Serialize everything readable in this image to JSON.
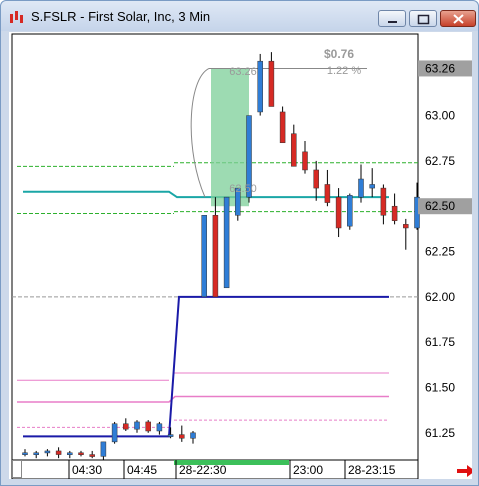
{
  "window": {
    "title": "S.FSLR - First Solar, Inc, 3 Min"
  },
  "chart_data": {
    "type": "candlestick",
    "ylim": [
      61.1,
      63.45
    ],
    "y_ticks": [
      "61.25",
      "61.50",
      "61.75",
      "62.00",
      "62.25",
      "62.50",
      "62.75",
      "63.00",
      "63.26"
    ],
    "x_tick_labels": [
      "04:30",
      "04:45",
      "28-22:30",
      "23:00",
      "28-23:15"
    ],
    "price_boxes": [
      {
        "value": 63.26,
        "label": "63.26"
      },
      {
        "value": 62.5,
        "label": "62.50"
      }
    ],
    "annotation": {
      "change": "$0.76",
      "percent": "1.22 %",
      "high_label": "63.26",
      "low_label": "62.50"
    },
    "candles": [
      {
        "o": 61.14,
        "h": 61.16,
        "l": 61.12,
        "c": 61.14
      },
      {
        "o": 61.13,
        "h": 61.15,
        "l": 61.11,
        "c": 61.14
      },
      {
        "o": 61.14,
        "h": 61.16,
        "l": 61.12,
        "c": 61.15
      },
      {
        "o": 61.15,
        "h": 61.17,
        "l": 61.11,
        "c": 61.13
      },
      {
        "o": 61.13,
        "h": 61.15,
        "l": 61.11,
        "c": 61.14
      },
      {
        "o": 61.14,
        "h": 61.15,
        "l": 61.12,
        "c": 61.13
      },
      {
        "o": 61.13,
        "h": 61.15,
        "l": 61.11,
        "c": 61.12
      },
      {
        "o": 61.12,
        "h": 61.2,
        "l": 61.1,
        "c": 61.2
      },
      {
        "o": 61.2,
        "h": 61.31,
        "l": 61.19,
        "c": 61.3
      },
      {
        "o": 61.3,
        "h": 61.33,
        "l": 61.26,
        "c": 61.27
      },
      {
        "o": 61.27,
        "h": 61.32,
        "l": 61.25,
        "c": 61.31
      },
      {
        "o": 61.31,
        "h": 61.32,
        "l": 61.25,
        "c": 61.26
      },
      {
        "o": 61.26,
        "h": 61.31,
        "l": 61.24,
        "c": 61.3
      },
      {
        "o": 61.24,
        "h": 61.28,
        "l": 61.22,
        "c": 61.24
      },
      {
        "o": 61.24,
        "h": 61.29,
        "l": 61.2,
        "c": 61.22
      },
      {
        "o": 61.22,
        "h": 61.26,
        "l": 61.19,
        "c": 61.25
      },
      {
        "o": 62.0,
        "h": 62.45,
        "l": 62.0,
        "c": 62.45
      },
      {
        "o": 62.45,
        "h": 62.55,
        "l": 62.0,
        "c": 62.0
      },
      {
        "o": 62.05,
        "h": 62.55,
        "l": 62.05,
        "c": 62.55
      },
      {
        "o": 62.45,
        "h": 62.6,
        "l": 62.42,
        "c": 62.6
      },
      {
        "o": 62.55,
        "h": 63.0,
        "l": 62.52,
        "c": 63.0
      },
      {
        "o": 63.02,
        "h": 63.34,
        "l": 63.0,
        "c": 63.3
      },
      {
        "o": 63.3,
        "h": 63.35,
        "l": 63.05,
        "c": 63.05
      },
      {
        "o": 63.02,
        "h": 63.05,
        "l": 62.85,
        "c": 62.85
      },
      {
        "o": 62.9,
        "h": 62.95,
        "l": 62.72,
        "c": 62.72
      },
      {
        "o": 62.8,
        "h": 62.86,
        "l": 62.68,
        "c": 62.7
      },
      {
        "o": 62.7,
        "h": 62.75,
        "l": 62.53,
        "c": 62.6
      },
      {
        "o": 62.62,
        "h": 62.7,
        "l": 62.5,
        "c": 62.52
      },
      {
        "o": 62.55,
        "h": 62.6,
        "l": 62.33,
        "c": 62.38
      },
      {
        "o": 62.39,
        "h": 62.57,
        "l": 62.37,
        "c": 62.56
      },
      {
        "o": 62.55,
        "h": 62.73,
        "l": 62.52,
        "c": 62.65
      },
      {
        "o": 62.6,
        "h": 62.71,
        "l": 62.55,
        "c": 62.62
      },
      {
        "o": 62.6,
        "h": 62.62,
        "l": 62.4,
        "c": 62.45
      },
      {
        "o": 62.5,
        "h": 62.57,
        "l": 62.4,
        "c": 62.42
      },
      {
        "o": 62.4,
        "h": 62.43,
        "l": 62.26,
        "c": 62.38
      },
      {
        "o": 62.38,
        "h": 62.63,
        "l": 62.37,
        "c": 62.55
      }
    ],
    "colors": {
      "up": "#2f7dd6",
      "down": "#d62a24",
      "wick": "#000000",
      "trend": "#1a1aa8",
      "cyan": "#1aa6a6",
      "green_dash": "#2db02d",
      "pink": "#e87dc8",
      "highlight": "#7ccf98"
    }
  },
  "scrollbar": {
    "arrow_icon": "red-right-arrow-icon"
  }
}
